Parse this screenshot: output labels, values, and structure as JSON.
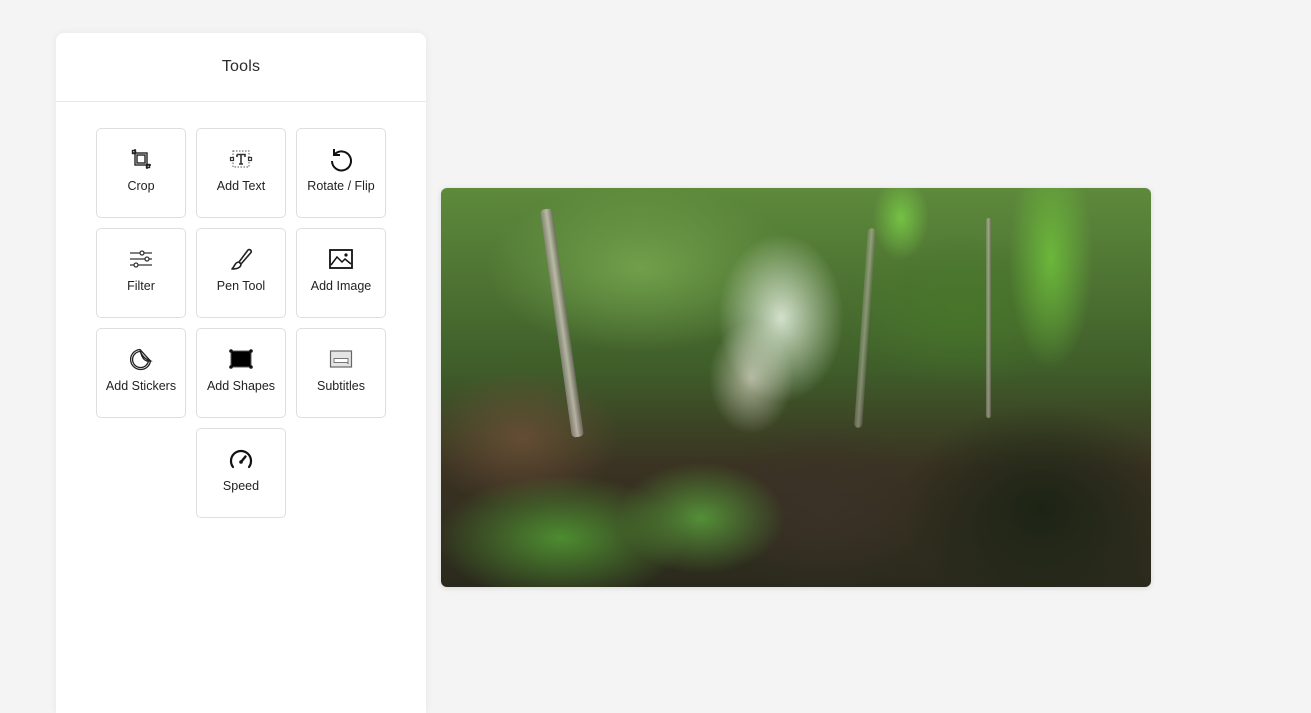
{
  "panel": {
    "title": "Tools"
  },
  "tools": [
    {
      "id": "crop",
      "label": "Crop",
      "icon": "crop-icon"
    },
    {
      "id": "add-text",
      "label": "Add Text",
      "icon": "text-box-icon"
    },
    {
      "id": "rotate-flip",
      "label": "Rotate / Flip",
      "icon": "rotate-icon"
    },
    {
      "id": "filter",
      "label": "Filter",
      "icon": "sliders-icon"
    },
    {
      "id": "pen-tool",
      "label": "Pen Tool",
      "icon": "brush-icon"
    },
    {
      "id": "add-image",
      "label": "Add Image",
      "icon": "image-icon"
    },
    {
      "id": "add-stickers",
      "label": "Add Stickers",
      "icon": "sticker-icon"
    },
    {
      "id": "add-shapes",
      "label": "Add Shapes",
      "icon": "rectangle-shape-icon"
    },
    {
      "id": "subtitles",
      "label": "Subtitles",
      "icon": "subtitles-icon"
    },
    {
      "id": "speed",
      "label": "Speed",
      "icon": "speedometer-icon"
    }
  ],
  "preview": {
    "description": "Video frame: forest trail through dense tropical foliage"
  }
}
